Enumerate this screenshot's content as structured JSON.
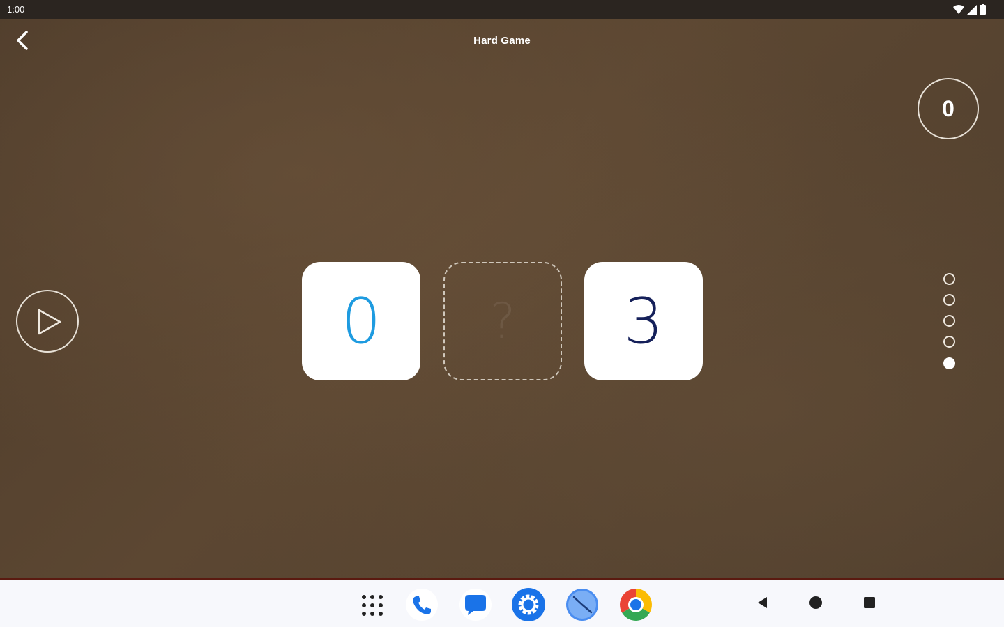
{
  "status_bar": {
    "time": "1:00"
  },
  "header": {
    "title": "Hard Game"
  },
  "score": {
    "value": "0"
  },
  "puzzle": {
    "tiles": [
      {
        "value": "0",
        "state": "revealed",
        "color": "#1e9be0"
      },
      {
        "value": "?",
        "state": "hidden"
      },
      {
        "value": "3",
        "state": "revealed",
        "color": "#15205a"
      }
    ]
  },
  "progress": {
    "total": 5,
    "current": 5
  },
  "taskbar": {
    "apps": [
      "apps-grid-icon",
      "phone-icon",
      "messages-icon",
      "settings-icon",
      "clock-icon",
      "chrome-icon"
    ],
    "nav": [
      "back-icon",
      "home-icon",
      "recents-icon"
    ]
  },
  "colors": {
    "accent": "#1e9be0",
    "dark_text": "#15205a",
    "background": "#5a4632"
  }
}
